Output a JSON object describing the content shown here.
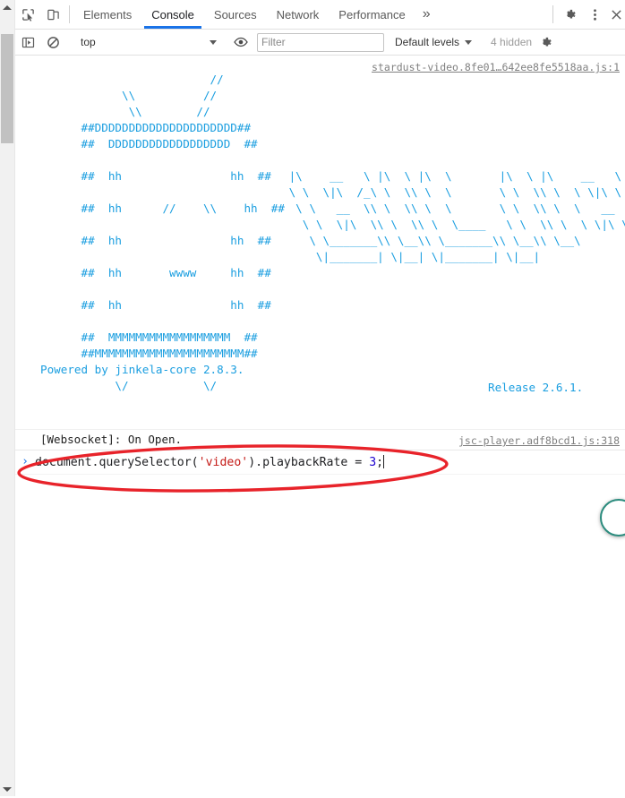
{
  "window": {
    "app": "Chrome DevTools",
    "active_panel": "Console"
  },
  "tabstrip": {
    "inspect_icon": "inspect-element-icon",
    "device_toolbar_icon": "device-toolbar-icon",
    "tabs": [
      {
        "label": "Elements",
        "active": false
      },
      {
        "label": "Console",
        "active": true
      },
      {
        "label": "Sources",
        "active": false
      },
      {
        "label": "Network",
        "active": false
      },
      {
        "label": "Performance",
        "active": true
      }
    ],
    "more_tabs_label": "»",
    "settings_icon": "gear-icon",
    "menu_icon": "kebab-menu-icon",
    "close_icon": "close-icon"
  },
  "console_toolbar": {
    "sidebar_toggle_icon": "console-sidebar-icon",
    "clear_icon": "clear-console-icon",
    "context": "top",
    "context_caret": "▾",
    "eye_icon": "live-expression-eye-icon",
    "filter_placeholder": "Filter",
    "filter_value": "",
    "levels_label": "Default levels",
    "levels_caret": "▾",
    "hidden_label": "4 hidden",
    "settings_icon": "console-settings-gear-icon"
  },
  "console": {
    "banner": {
      "source_link": "stardust-video.8fe01…642ee8fe5518aa.js:1",
      "release_text": "Release 2.6.1.",
      "ascii_color": "#1a9ee0",
      "logo_art": "                         //\n            \\\\          //\n             \\\\        //\n      ##DDDDDDDDDDDDDDDDDDDDD##\n      ##  DDDDDDDDDDDDDDDDDD  ##\n\n      ##  hh                hh  ##\n\n      ##  hh      //    \\\\    hh  ##\n\n      ##  hh                hh  ##\n\n      ##  hh       wwww     hh  ##\n\n      ##  hh                hh  ##\n\n      ##  MMMMMMMMMMMMMMMMMM  ##\n      ##MMMMMMMMMMMMMMMMMMMMMM##\nPowered by jinkela-core 2.8.3.\n           \\/           \\/",
      "wordmark_art": " |\\    __   \\ |\\  \\ |\\  \\       |\\  \\ |\\    __   \\\n \\ \\  \\|\\  /_\\ \\  \\\\ \\  \\       \\ \\  \\\\ \\  \\ \\|\\ \\\n  \\ \\   __  \\\\ \\  \\\\ \\  \\       \\ \\  \\\\ \\  \\   __\n   \\ \\  \\|\\  \\\\ \\  \\\\ \\  \\____   \\ \\  \\\\ \\  \\ \\|\\ \\\n    \\ \\_______\\\\ \\__\\\\ \\_______\\\\ \\__\\\\ \\__\\\n     \\|_______| \\|__| \\|_______| \\|__|",
      "powered_by": "Powered by jinkela-core 2.8.3."
    },
    "websocket_message": {
      "text": "[Websocket]: On Open.",
      "source_link": "jsc-player.adf8bcd1.js:318"
    }
  },
  "prompt": {
    "chevron": "›",
    "code_parts": [
      {
        "text": "document.querySelector(",
        "type": "plain"
      },
      {
        "text": "'video'",
        "type": "string"
      },
      {
        "text": ").playbackRate = ",
        "type": "plain"
      },
      {
        "text": "3",
        "type": "number"
      },
      {
        "text": ";",
        "type": "plain"
      }
    ],
    "code_plain_1": "document.querySelector(",
    "code_string": "'video'",
    "code_plain_2": ").playbackRate = ",
    "code_number": "3",
    "code_plain_3": ";"
  },
  "annotation": {
    "shape": "ellipse",
    "color": "#e8232a",
    "target": "console-prompt-input"
  },
  "colors": {
    "accent_blue": "#1a73e8",
    "ascii_blue": "#1a9ee0",
    "annotation_red": "#e8232a",
    "string_red": "#c41a16",
    "number_blue": "#1c00cf",
    "widget_teal": "#2b8c7e"
  }
}
